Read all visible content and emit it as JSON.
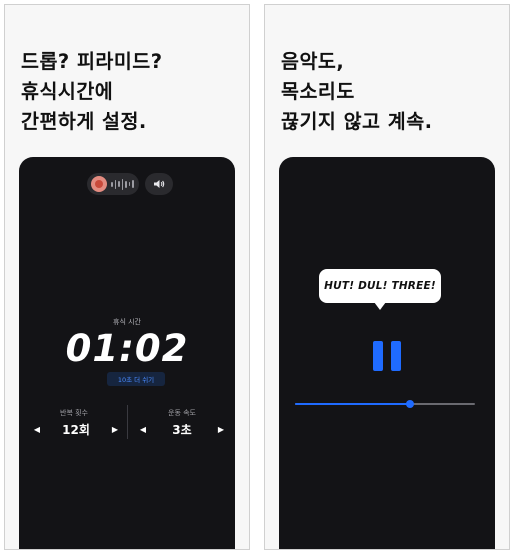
{
  "left": {
    "headline": [
      "드롭? 피라미드?",
      "휴식시간에",
      "간편하게 설정."
    ],
    "phone": {
      "rest_label": "휴식 시간",
      "timer": "01:02",
      "rest_more_button": "10초 더 쉬기",
      "reps": {
        "label": "반복 횟수",
        "value": "12회"
      },
      "speed": {
        "label": "운동 속도",
        "value": "3초"
      },
      "arrow_left": "◀",
      "arrow_right": "▶"
    }
  },
  "right": {
    "headline": [
      "음악도,",
      "목소리도",
      "끊기지 않고 계속."
    ],
    "phone": {
      "speech_bubble": "HUT! DUL! THREE!",
      "playback_progress": 0.64
    }
  },
  "colors": {
    "accent": "#1f6bff",
    "phone_bg": "#131316",
    "panel_bg": "#f7f7f7"
  }
}
